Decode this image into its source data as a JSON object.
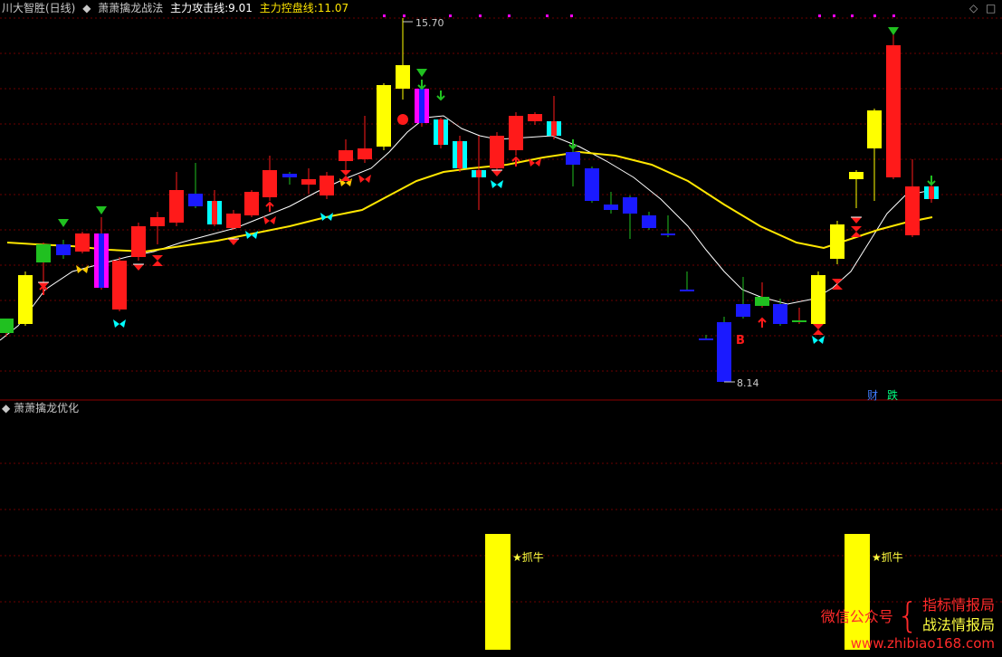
{
  "header": {
    "stock": "川大智胜(日线)",
    "indicator": "萧萧擒龙战法",
    "attack_label": "主力攻击线:",
    "attack_value": "9.01",
    "control_label": "主力控盘线:",
    "control_value": "11.07"
  },
  "sub_header": {
    "title": "萧萧擒龙优化"
  },
  "corner_icons": {
    "diamond": "◇",
    "square": "□"
  },
  "tags": {
    "cai": "财",
    "die": "跌"
  },
  "brand": {
    "left": "微信公众号",
    "right_top": "指标情报局",
    "right_bottom": "战法情报局",
    "url": "www.zhibiao168.com"
  },
  "chart_data": {
    "type": "candlestick",
    "price_high_label": "15.70",
    "price_low_label": "8.14",
    "signal_labels": {
      "buy": "B",
      "zhuaniu": "抓牛"
    },
    "colors": {
      "up": "#ff1a1a",
      "down": "#1a1aff",
      "attack_line": "#ffffff",
      "control_line": "#ffe600",
      "signal_bar": "#ffff00",
      "grid": "#6b0000",
      "separator": "#8b0000",
      "header_gray": "#c8c8c8",
      "label_yellow": "#ffff40",
      "tag_blue": "#3f7cff",
      "tag_green": "#00ff80",
      "cyan": "#00ffff",
      "magenta": "#ff00ff",
      "green_mark": "#20c020"
    },
    "subchart_signals": [
      {
        "label": "抓牛"
      },
      {
        "label": "抓牛"
      }
    ]
  }
}
